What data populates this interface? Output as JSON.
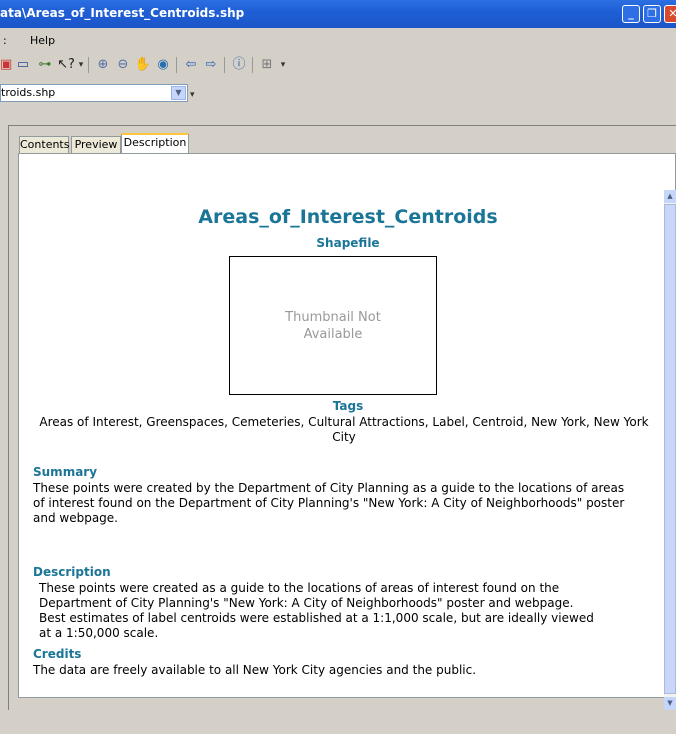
{
  "window": {
    "title": "ata\\Areas_of_Interest_Centroids.shp"
  },
  "menu": {
    "items": [
      ":",
      "Help"
    ]
  },
  "toolbar": {
    "icons": [
      "catalog-icon",
      "window-icon",
      "connect-icon",
      "whats-this-icon",
      "zoom-in-icon",
      "zoom-out-icon",
      "pan-icon",
      "full-extent-icon",
      "back-icon",
      "forward-icon",
      "identify-icon",
      "layout-icon"
    ]
  },
  "location": {
    "value": "troids.shp"
  },
  "tabs": [
    {
      "label": "Contents"
    },
    {
      "label": "Preview"
    },
    {
      "label": "Description"
    }
  ],
  "doc": {
    "title": "Areas_of_Interest_Centroids",
    "subtitle": "Shapefile",
    "thumbnail_text": "Thumbnail Not Available",
    "tags_heading": "Tags",
    "tags_text": "Areas of Interest, Greenspaces, Cemeteries, Cultural Attractions, Label, Centroid, New York, New York City",
    "summary_heading": "Summary",
    "summary_text": "These points were created by the Department of City Planning as a guide to the locations of areas of interest found on the Department of City Planning's \"New York: A City of Neighborhoods\" poster and webpage.",
    "description_heading": "Description",
    "description_text": "These points were created as a guide to the locations of areas of interest found on the Department of City Planning's \"New York: A City of Neighborhoods\"  poster and webpage. Best estimates of label centroids were established at a 1:1,000 scale, but are ideally viewed at a 1:50,000 scale.",
    "credits_heading": "Credits",
    "credits_text": "The data are freely available to all New York City agencies and the public."
  },
  "colors": {
    "heading": "#1a7596",
    "titlebar": "#1f5fd6"
  }
}
